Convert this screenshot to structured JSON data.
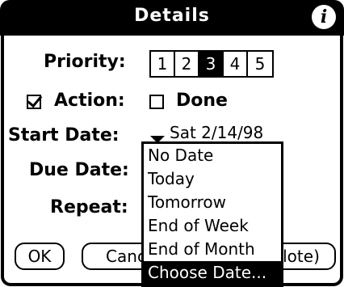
{
  "window": {
    "title": "Details"
  },
  "icons": {
    "info": "info-icon",
    "dropdown": "triangle-down-icon",
    "check": "checkmark-icon"
  },
  "priority": {
    "label": "Priority:",
    "options": [
      "1",
      "2",
      "3",
      "4",
      "5"
    ],
    "selected": "3"
  },
  "action": {
    "label": "Action:",
    "checked": true
  },
  "done": {
    "label": "Done",
    "checked": false
  },
  "start_date": {
    "label": "Start Date:",
    "value": "Sat 2/14/98"
  },
  "due_date": {
    "label": "Due Date:"
  },
  "repeat": {
    "label": "Repeat:"
  },
  "buttons": {
    "ok": "OK",
    "cancel": "Canc",
    "note": "lote)"
  },
  "menu": {
    "items": [
      "No Date",
      "Today",
      "Tomorrow",
      "End of Week",
      "End of Month",
      "Choose Date..."
    ],
    "selected_index": 5
  }
}
